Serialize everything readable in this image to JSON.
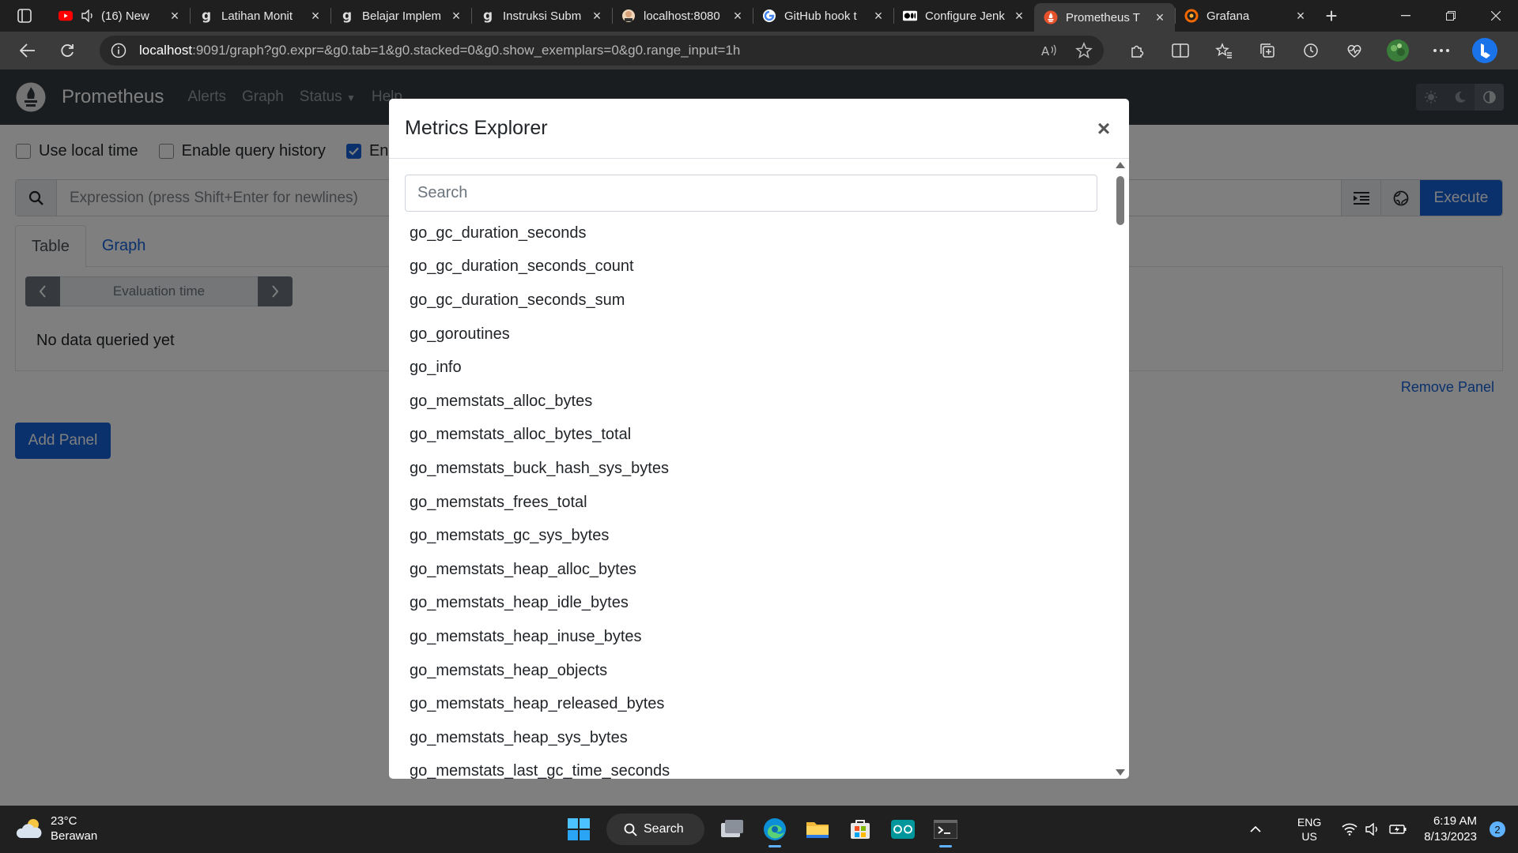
{
  "browser": {
    "tabs": [
      {
        "title": "(16) New",
        "icon": "youtube-icon"
      },
      {
        "title": "Latihan Monit",
        "icon": "dicoding-icon"
      },
      {
        "title": "Belajar Implem",
        "icon": "dicoding-icon"
      },
      {
        "title": "Instruksi Subm",
        "icon": "dicoding-icon"
      },
      {
        "title": "localhost:8080",
        "icon": "jenkins-icon"
      },
      {
        "title": "GitHub hook t",
        "icon": "google-icon"
      },
      {
        "title": "Configure Jenk",
        "icon": "medium-icon"
      },
      {
        "title": "Prometheus T",
        "icon": "prometheus-icon",
        "active": true
      },
      {
        "title": "Grafana",
        "icon": "grafana-icon"
      }
    ],
    "url_host": "localhost",
    "url_rest": ":9091/graph?g0.expr=&g0.tab=1&g0.stacked=0&g0.show_exemplars=0&g0.range_input=1h"
  },
  "prometheus": {
    "brand": "Prometheus",
    "nav": {
      "alerts": "Alerts",
      "graph": "Graph",
      "status": "Status",
      "help": "Help"
    },
    "options": {
      "local_time": "Use local time",
      "query_history": "Enable query history",
      "enable": "Ena"
    },
    "expression_placeholder": "Expression (press Shift+Enter for newlines)",
    "execute": "Execute",
    "tabs": {
      "table": "Table",
      "graph": "Graph"
    },
    "evaluation_time": "Evaluation time",
    "no_data": "No data queried yet",
    "remove_panel": "Remove Panel",
    "add_panel": "Add Panel"
  },
  "modal": {
    "title": "Metrics Explorer",
    "close": "×",
    "search_placeholder": "Search",
    "metrics": [
      "go_gc_duration_seconds",
      "go_gc_duration_seconds_count",
      "go_gc_duration_seconds_sum",
      "go_goroutines",
      "go_info",
      "go_memstats_alloc_bytes",
      "go_memstats_alloc_bytes_total",
      "go_memstats_buck_hash_sys_bytes",
      "go_memstats_frees_total",
      "go_memstats_gc_sys_bytes",
      "go_memstats_heap_alloc_bytes",
      "go_memstats_heap_idle_bytes",
      "go_memstats_heap_inuse_bytes",
      "go_memstats_heap_objects",
      "go_memstats_heap_released_bytes",
      "go_memstats_heap_sys_bytes",
      "go_memstats_last_gc_time_seconds"
    ]
  },
  "taskbar": {
    "temperature": "23°C",
    "weather": "Berawan",
    "search": "Search",
    "lang1": "ENG",
    "lang2": "US",
    "time": "6:19 AM",
    "date": "8/13/2023",
    "notifications": "2"
  },
  "colors": {
    "accent": "#1463d9",
    "navbar": "#343a40"
  }
}
